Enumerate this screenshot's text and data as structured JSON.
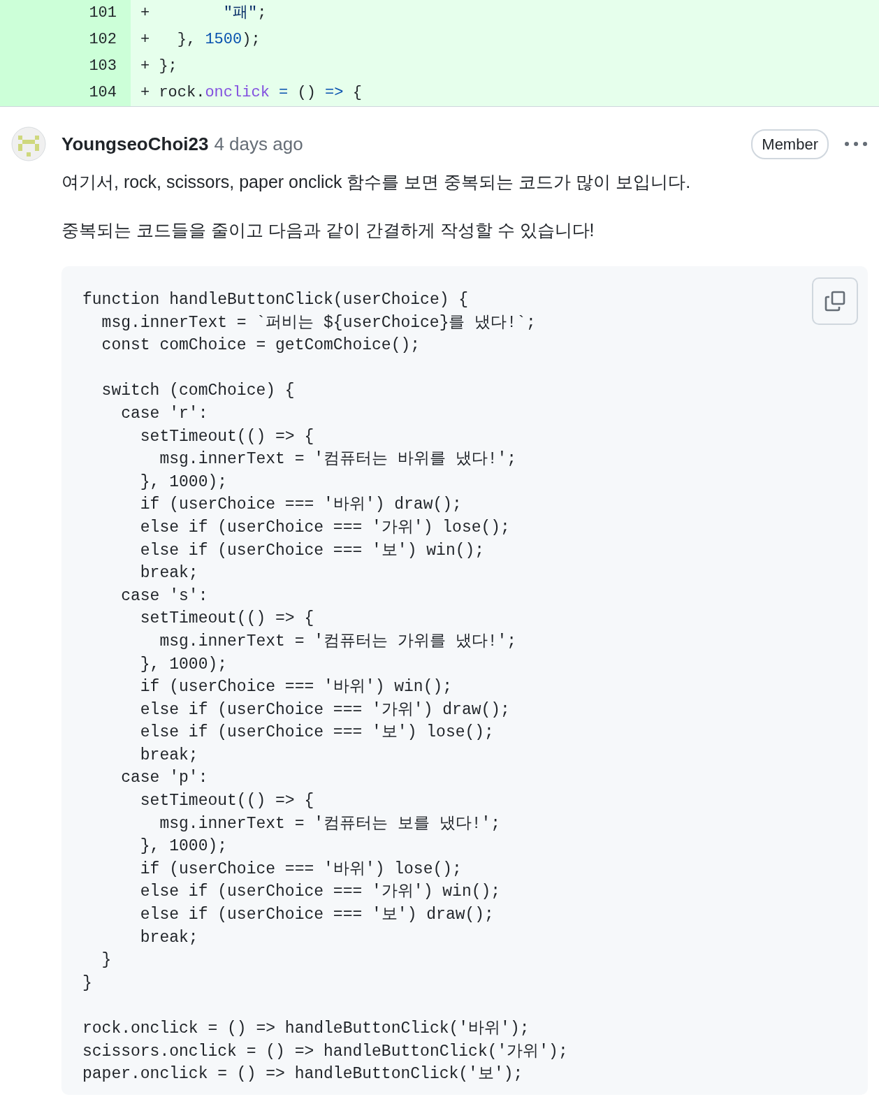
{
  "diff_lines": [
    {
      "number": "101",
      "segments": [
        {
          "kind": "plain",
          "text": "+        "
        },
        {
          "kind": "string",
          "text": "\"패\""
        },
        {
          "kind": "plain",
          "text": ";"
        }
      ]
    },
    {
      "number": "102",
      "segments": [
        {
          "kind": "plain",
          "text": "+   }, "
        },
        {
          "kind": "number",
          "text": "1500"
        },
        {
          "kind": "plain",
          "text": ");"
        }
      ]
    },
    {
      "number": "103",
      "segments": [
        {
          "kind": "plain",
          "text": "+ };"
        }
      ]
    },
    {
      "number": "104",
      "segments": [
        {
          "kind": "plain",
          "text": "+ rock."
        },
        {
          "kind": "property",
          "text": "onclick"
        },
        {
          "kind": "keyword",
          "text": " ="
        },
        {
          "kind": "plain",
          "text": " () "
        },
        {
          "kind": "keyword",
          "text": "=>"
        },
        {
          "kind": "plain",
          "text": " {"
        }
      ]
    }
  ],
  "comment": {
    "author": "YoungseoChoi23",
    "time": "4 days ago",
    "role_badge": "Member",
    "paragraphs": [
      "여기서, rock, scissors, paper onclick 함수를 보면 중복되는 코드가 많이 보입니다.",
      "중복되는 코드들을 줄이고 다음과 같이 간결하게 작성할 수 있습니다!"
    ],
    "code_block": {
      "groups": [
        [
          "function handleButtonClick(userChoice) {",
          "  msg.innerText = `퍼비는 ${userChoice}를 냈다!`;",
          "  const comChoice = getComChoice();"
        ],
        [
          "  switch (comChoice) {",
          "    case 'r':",
          "      setTimeout(() => {",
          "        msg.innerText = '컴퓨터는 바위를 냈다!';",
          "      }, 1000);",
          "      if (userChoice === '바위') draw();",
          "      else if (userChoice === '가위') lose();",
          "      else if (userChoice === '보') win();",
          "      break;",
          "    case 's':",
          "      setTimeout(() => {",
          "        msg.innerText = '컴퓨터는 가위를 냈다!';",
          "      }, 1000);",
          "      if (userChoice === '바위') win();",
          "      else if (userChoice === '가위') draw();",
          "      else if (userChoice === '보') lose();",
          "      break;",
          "    case 'p':",
          "      setTimeout(() => {",
          "        msg.innerText = '컴퓨터는 보를 냈다!';",
          "      }, 1000);",
          "      if (userChoice === '바위') lose();",
          "      else if (userChoice === '가위') win();",
          "      else if (userChoice === '보') draw();",
          "      break;",
          "  }",
          "}"
        ],
        [
          "rock.onclick = () => handleButtonClick('바위');",
          "scissors.onclick = () => handleButtonClick('가위');",
          "paper.onclick = () => handleButtonClick('보');"
        ]
      ]
    }
  }
}
